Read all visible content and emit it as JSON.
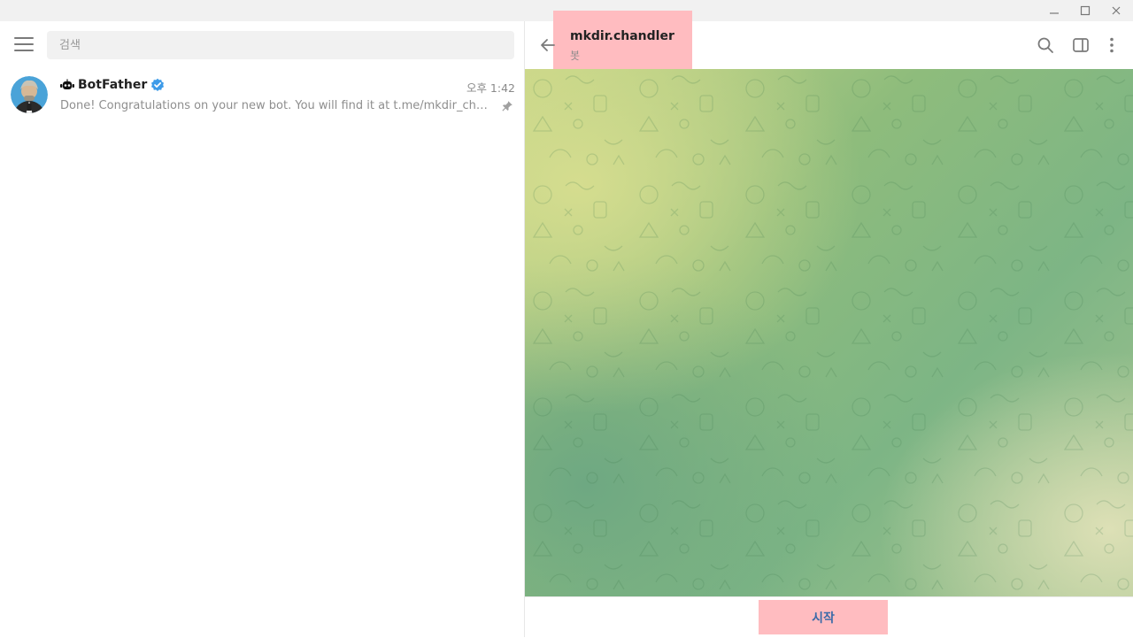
{
  "window": {
    "minimize_glyph": "—",
    "maximize_glyph": "☐",
    "close_glyph": "✕"
  },
  "left_panel": {
    "search_placeholder": "검색",
    "chats": [
      {
        "name": "BotFather",
        "time": "오후 1:42",
        "preview": "Done! Congratulations on your new bot. You will find it at t.me/mkdir_chandler_bot. You can now add a description...",
        "verified": true,
        "pinned": true,
        "name_icon": "bot-icon"
      }
    ]
  },
  "chat": {
    "title": "mkdir.chandler",
    "subtitle": "봇",
    "start_button": "시작"
  },
  "colors": {
    "highlight": "#ffbcc0",
    "verified": "#3d9be9",
    "link": "#3a6aa8"
  }
}
